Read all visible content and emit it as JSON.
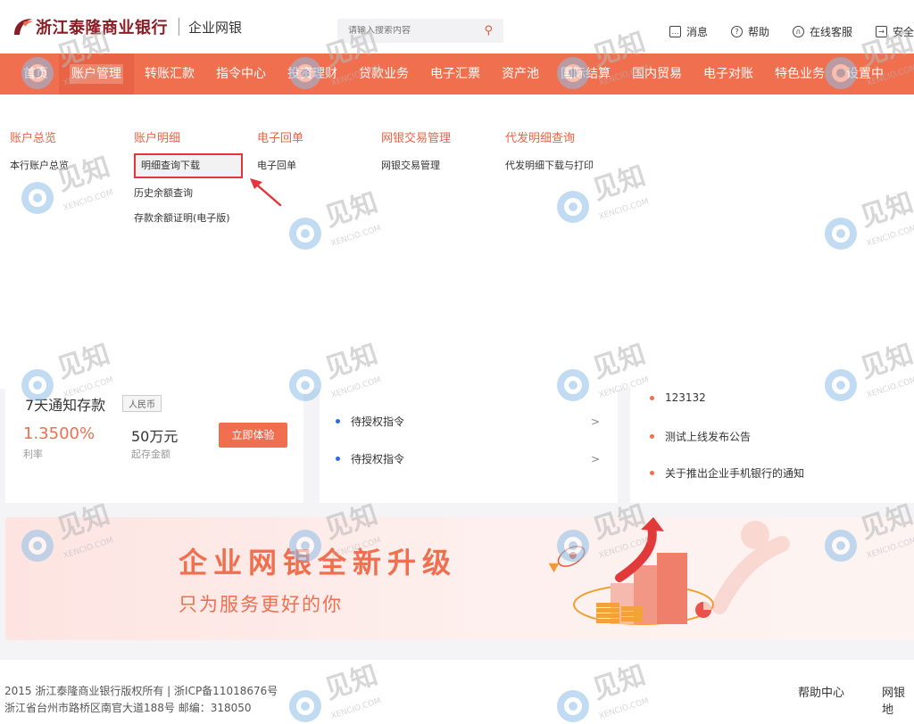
{
  "header": {
    "brand": "浙江泰隆商业银行",
    "product": "企业网银",
    "search_placeholder": "请输入搜索内容",
    "links": [
      {
        "label": "消息",
        "icon": "message-icon"
      },
      {
        "label": "帮助",
        "icon": "help-icon"
      },
      {
        "label": "在线客服",
        "icon": "headset-icon"
      },
      {
        "label": "安全",
        "icon": "exit-icon"
      }
    ]
  },
  "nav": {
    "items": [
      "首页",
      "账户管理",
      "转账汇款",
      "指令中心",
      "投资理财",
      "贷款业务",
      "电子汇票",
      "资产池",
      "国际结算",
      "国内贸易",
      "电子对账",
      "特色业务",
      "设置中"
    ]
  },
  "dropdown": {
    "columns": [
      {
        "title": "账户总览",
        "items": [
          "本行账户总览"
        ]
      },
      {
        "title": "账户明细",
        "items": [
          "明细查询下载",
          "历史余额查询",
          "存款余额证明(电子版)"
        ]
      },
      {
        "title": "电子回单",
        "items": [
          "电子回单"
        ]
      },
      {
        "title": "网银交易管理",
        "items": [
          "网银交易管理"
        ]
      },
      {
        "title": "代发明细查询",
        "items": [
          "代发明细下载与打印"
        ]
      }
    ]
  },
  "product_card": {
    "title": "7天通知存款",
    "badge": "人民币",
    "rate": "1.3500%",
    "rate_label": "利率",
    "amount": "50万元",
    "amount_label": "起存金额",
    "button": "立即体验"
  },
  "todo": {
    "items": [
      "待授权指令",
      "待授权指令"
    ]
  },
  "notices": {
    "items": [
      "123132",
      "测试上线发布公告",
      "关于推出企业手机银行的通知"
    ]
  },
  "banner": {
    "title": "企业网银全新升级",
    "subtitle": "只为服务更好的你"
  },
  "footer": {
    "copyright": "2015 浙江泰隆商业银行版权所有 | 浙ICP备11018676号",
    "address": "浙江省台州市路桥区南官大道188号 邮编：318050",
    "links": [
      "帮助中心",
      "网银地"
    ]
  },
  "watermark": {
    "text": "见知",
    "domain": "XENCIO.COM"
  },
  "colors": {
    "accent": "#ef6f4f",
    "brand": "#8b1d24",
    "highlight_border": "#e5343a"
  }
}
